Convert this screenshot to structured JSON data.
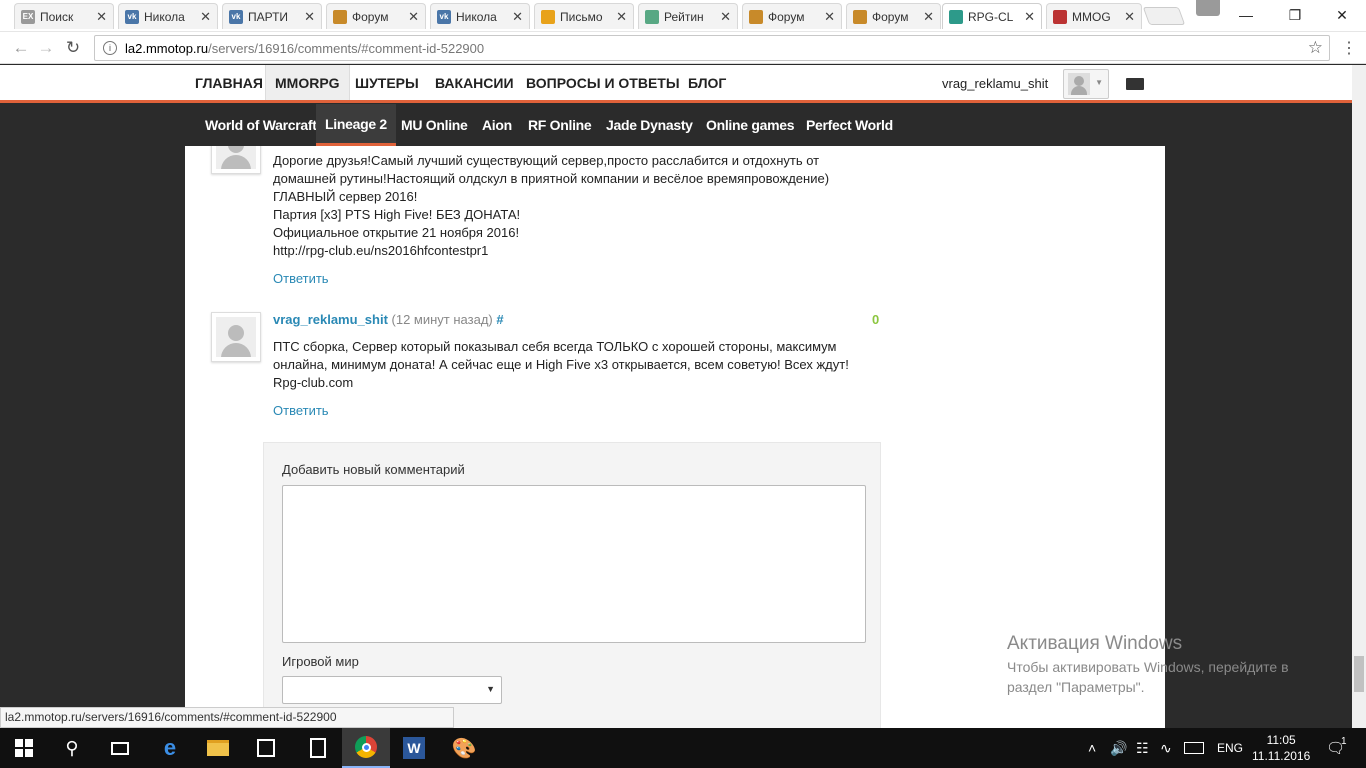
{
  "browser": {
    "tabs": [
      {
        "title": "Поиск",
        "favicon": "ex-icon",
        "fav_text": "EX",
        "fav_color": "#999999"
      },
      {
        "title": "Никола",
        "favicon": "vk-icon",
        "fav_text": "vk",
        "fav_color": "#4a76a8"
      },
      {
        "title": "ПАРТИ",
        "favicon": "vk-icon",
        "fav_text": "vk",
        "fav_color": "#4a76a8"
      },
      {
        "title": "Форум",
        "favicon": "forum-icon",
        "fav_text": "",
        "fav_color": "#c88a2a"
      },
      {
        "title": "Никола",
        "favicon": "vk-icon",
        "fav_text": "vk",
        "fav_color": "#4a76a8"
      },
      {
        "title": "Письмо",
        "favicon": "mail-icon",
        "fav_text": "",
        "fav_color": "#e8a21a"
      },
      {
        "title": "Рейтин",
        "favicon": "rating-icon",
        "fav_text": "",
        "fav_color": "#58a884"
      },
      {
        "title": "Форум",
        "favicon": "forum-icon",
        "fav_text": "",
        "fav_color": "#c88a2a"
      },
      {
        "title": "Форум",
        "favicon": "forum-icon",
        "fav_text": "",
        "fav_color": "#c88a2a"
      },
      {
        "title": "RPG-CL",
        "favicon": "rpg-icon",
        "fav_text": "",
        "fav_color": "#2d9a8a"
      },
      {
        "title": "MMOG",
        "favicon": "mmog-icon",
        "fav_text": "",
        "fav_color": "#b33"
      }
    ],
    "url_host": "la2.mmotop.ru",
    "url_path": "/servers/16916/comments/#comment-id-522900",
    "status_url": "la2.mmotop.ru/servers/16916/comments/#comment-id-522900"
  },
  "site": {
    "main_nav": [
      "ГЛАВНАЯ",
      "MMORPG",
      "ШУТЕРЫ",
      "ВАКАНСИИ",
      "ВОПРОСЫ И ОТВЕТЫ",
      "БЛОГ"
    ],
    "username": "vrag_reklamu_shit",
    "sub_nav": [
      "World of Warcraft",
      "Lineage 2",
      "MU Online",
      "Aion",
      "RF Online",
      "Jade Dynasty",
      "Online games",
      "Perfect World"
    ]
  },
  "comments": [
    {
      "lines": [
        "Дорогие друзья!Самый лучший существующий сервер,просто расслабится и отдохнуть от",
        "домашней рутины!Настоящий олдскул в приятной компании и весёлое времяпровождение)",
        "ГЛАВНЫЙ сервер 2016!",
        "Партия [x3] PTS High Five! БЕЗ ДОНАТА!",
        "Официальное открытие 21 ноября 2016!",
        "http://rpg-club.eu/ns2016hfcontestpr1"
      ],
      "reply": "Ответить"
    },
    {
      "author": "vrag_reklamu_shit",
      "time": "(12 минут назад)",
      "anchor": "#",
      "rating": "0",
      "lines": [
        "ПТС сборка, Сервер который показывал себя всегда ТОЛЬКО с хорошей стороны, максимум",
        "онлайна, минимум доната! А сейчас еще и High Five x3 открывается, всем советую! Всех ждут!",
        "Rpg-club.com"
      ],
      "reply": "Ответить"
    }
  ],
  "form": {
    "comment_label": "Добавить новый комментарий",
    "world_label": "Игровой мир",
    "world_value": ""
  },
  "watermark": {
    "title": "Активация Windows",
    "text": "Чтобы активировать Windows, перейдите в раздел \"Параметры\"."
  },
  "taskbar": {
    "lang": "ENG",
    "time": "11:05",
    "date": "11.11.2016",
    "notifications": "1"
  },
  "colors": {
    "accent": "#e0623a",
    "link": "#2a89b5",
    "rating": "#8cc63f"
  }
}
